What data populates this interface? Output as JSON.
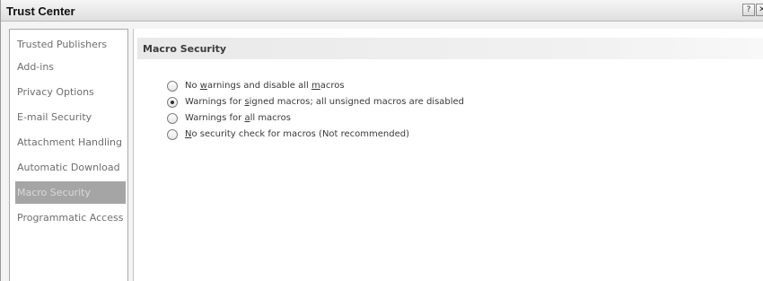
{
  "window": {
    "title": "Trust Center",
    "help_icon": "help-icon",
    "close_icon": "close-icon"
  },
  "sidebar": {
    "selected_index": 6,
    "items": [
      {
        "label": "Trusted Publishers"
      },
      {
        "label": "Add-ins"
      },
      {
        "label": "Privacy Options"
      },
      {
        "label": "E-mail Security"
      },
      {
        "label": "Attachment Handling"
      },
      {
        "label": "Automatic Download"
      },
      {
        "label": "Macro Security"
      },
      {
        "label": "Programmatic Access"
      }
    ]
  },
  "main": {
    "section_title": "Macro Security",
    "selected_option": 1,
    "options": [
      {
        "pre": "No ",
        "mnemonic": "w",
        "post": "arnings and disable all ",
        "mnemonic2": "m",
        "post2": "acros"
      },
      {
        "pre": "Warnings for ",
        "mnemonic": "s",
        "post": "igned macros; all unsigned macros are disabled",
        "mnemonic2": "",
        "post2": ""
      },
      {
        "pre": "Warnings for ",
        "mnemonic": "a",
        "post": "ll macros",
        "mnemonic2": "",
        "post2": ""
      },
      {
        "pre": "",
        "mnemonic": "N",
        "post": "o security check for macros (Not recommended)",
        "mnemonic2": "",
        "post2": ""
      }
    ]
  }
}
